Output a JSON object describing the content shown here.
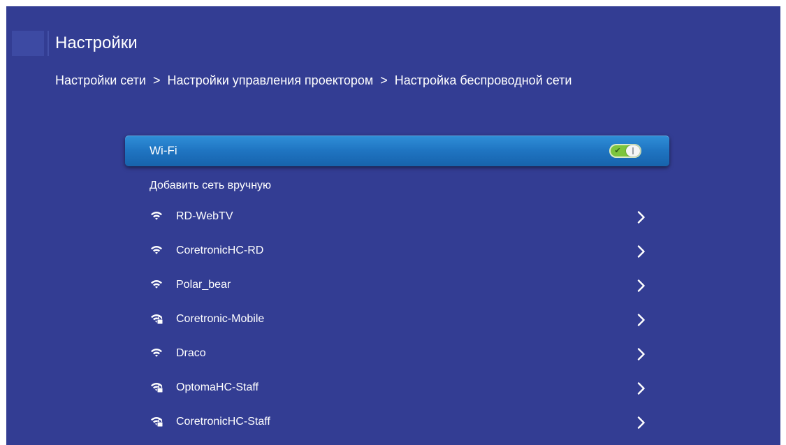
{
  "header": {
    "title": "Настройки"
  },
  "breadcrumb": {
    "items": [
      "Настройки сети",
      "Настройки управления проектором",
      "Настройка беспроводной сети"
    ],
    "separator": ">"
  },
  "wifi": {
    "label": "Wi-Fi",
    "enabled": true
  },
  "add_network": {
    "label": "Добавить сеть вручную"
  },
  "networks": [
    {
      "name": "RD-WebTV",
      "icon": "wifi-icon",
      "secured": false
    },
    {
      "name": "CoretronicHC-RD",
      "icon": "wifi-icon",
      "secured": false
    },
    {
      "name": "Polar_bear",
      "icon": "wifi-icon",
      "secured": false
    },
    {
      "name": "Coretronic-Mobile",
      "icon": "wifi-lock-icon",
      "secured": true
    },
    {
      "name": "Draco",
      "icon": "wifi-icon",
      "secured": false
    },
    {
      "name": "OptomaHC-Staff",
      "icon": "wifi-lock-icon",
      "secured": true
    },
    {
      "name": "CoretronicHC-Staff",
      "icon": "wifi-lock-icon",
      "secured": true
    }
  ],
  "colors": {
    "background": "#333d93",
    "selected_row": "#1f74c1",
    "toggle_on": "#7cc53d"
  }
}
